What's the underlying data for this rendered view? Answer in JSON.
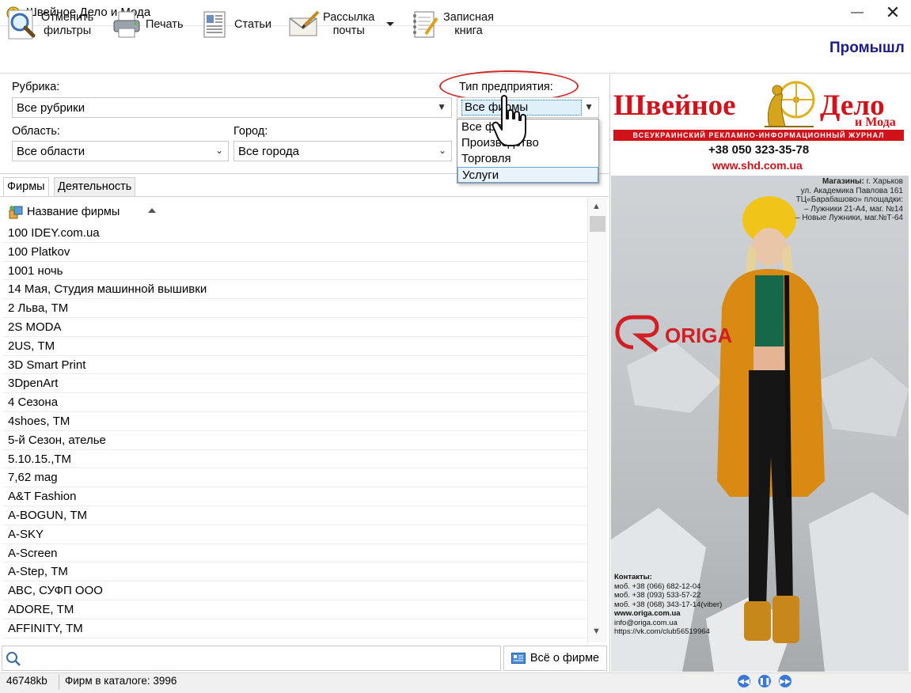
{
  "window": {
    "title": "Швейное Дело и Мода",
    "minimize_glyph": "—",
    "close_glyph": "✕"
  },
  "toolbar": {
    "cancel_filters_line1": "Отменить",
    "cancel_filters_line2": "фильтры",
    "print_label": "Печать",
    "articles_label": "Статьи",
    "mailing_line1": "Рассылка",
    "mailing_line2": "почты",
    "notebook_line1": "Записная",
    "notebook_line2": "книга",
    "promo_text": "Промышл"
  },
  "filters": {
    "rubric_label": "Рубрика:",
    "rubric_value": "Все рубрики",
    "region_label": "Область:",
    "region_value": "Все области",
    "city_label": "Город:",
    "city_value": "Все города",
    "type_label": "Тип предприятия:",
    "type_value": "Все фирмы",
    "type_options": [
      "Все фирмы",
      "Производство",
      "Торговля",
      "Услуги"
    ],
    "type_highlighted": "Услуги"
  },
  "tabs": {
    "firms": "Фирмы",
    "activity": "Деятельность"
  },
  "list": {
    "header": "Название фирмы",
    "rows": [
      "100 IDEY.com.ua",
      "100 Platkov",
      "1001 ночь",
      "14 Мая, Студия машинной вышивки",
      "2 Льва, ТМ",
      "2S MODA",
      "2US, ТМ",
      "3D Smart Print",
      "3DpenArt",
      "4 Сезона",
      "4shoes, ТМ",
      "5-й Сезон, ателье",
      "5.10.15.,ТМ",
      "7,62 mag",
      "A&T Fashion",
      "A-BOGUN, ТМ",
      "A-SKY",
      "A-Screen",
      "A-Step, ТМ",
      "ABC, СУФП ООО",
      "ADORE, ТМ",
      "AFFINITY, ТМ"
    ]
  },
  "search": {
    "placeholder": "",
    "about_button": "Всё о фирме"
  },
  "status": {
    "memory": "46748kb",
    "count": "Фирм в каталоге: 3996"
  },
  "banner": {
    "title_part1": "Швейное",
    "title_part2": "Дело",
    "title_part3": "и Мода",
    "subtitle": "ВСЕУКРАИНСКИЙ РЕКЛАМНО-ИНФОРМАЦИОННЫЙ ЖУРНАЛ",
    "phone": "+38 050 323-35-78",
    "url": "www.shd.com.ua"
  },
  "ad": {
    "shops_title": "Магазины:",
    "shops_city": "г. Харьков",
    "shops_lines": [
      "ул. Академика Павлова 161",
      "ТЦ«Барабашово» площадки:",
      "– Лужники 21-А4, маг. №14",
      "– Новые Лужники, маг.№Т-64"
    ],
    "brand": "ORIGA",
    "contacts_title": "Контакты:",
    "contacts_lines": [
      "моб. +38 (066) 682-12-04",
      "моб. +38 (093) 533-57-22",
      "моб. +38 (068) 343-17-14(viber)"
    ],
    "website": "www.origa.com.ua",
    "email": "info@origa.com.ua",
    "social": "https://vk.com/club56519964"
  },
  "colors": {
    "brand_red": "#d0121b",
    "promo_blue": "#1c1c8a",
    "highlight_blue": "#66a6db",
    "annotation_red": "#d12828"
  }
}
